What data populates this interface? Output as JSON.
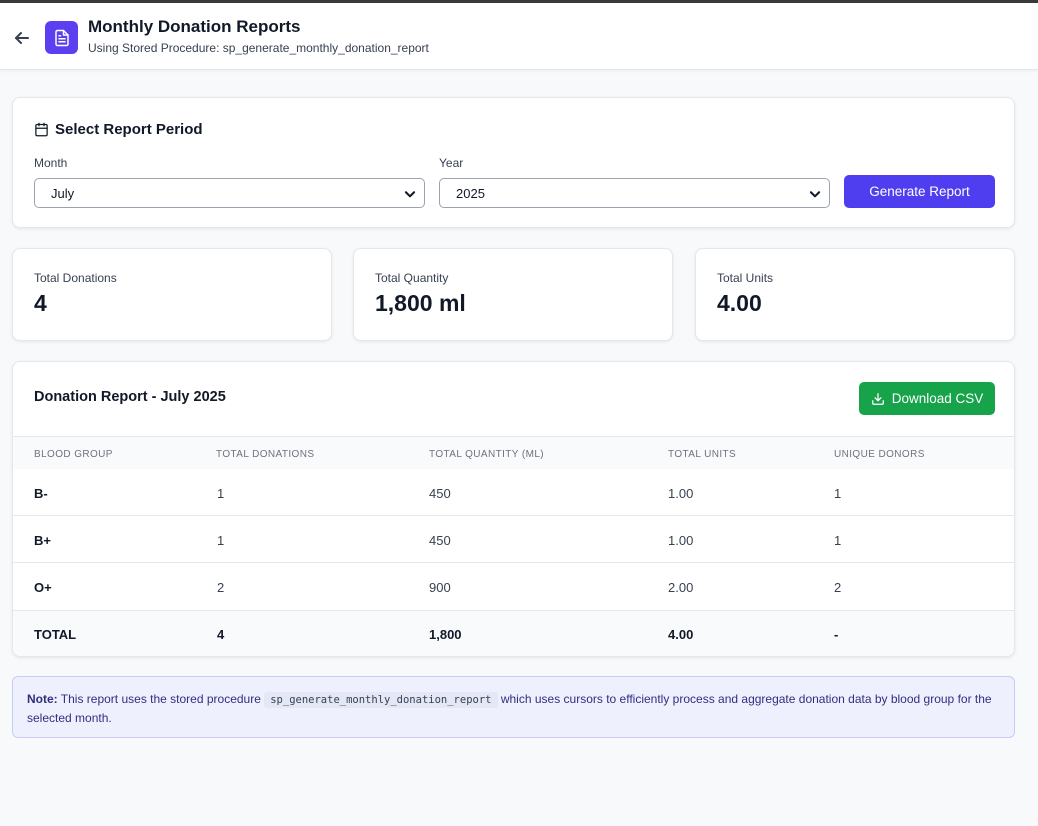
{
  "header": {
    "title": "Monthly Donation Reports",
    "subtitle": "Using Stored Procedure: sp_generate_monthly_donation_report"
  },
  "period": {
    "title": "Select Report Period",
    "month_label": "Month",
    "month_value": "July",
    "year_label": "Year",
    "year_value": "2025",
    "generate_label": "Generate Report"
  },
  "stats": [
    {
      "label": "Total Donations",
      "value": "4"
    },
    {
      "label": "Total Quantity",
      "value": "1,800 ml"
    },
    {
      "label": "Total Units",
      "value": "4.00"
    }
  ],
  "report": {
    "title": "Donation Report - July 2025",
    "download_label": "Download CSV",
    "columns": [
      "BLOOD GROUP",
      "TOTAL DONATIONS",
      "TOTAL QUANTITY (ML)",
      "TOTAL UNITS",
      "UNIQUE DONORS"
    ],
    "rows": [
      [
        "B-",
        "1",
        "450",
        "1.00",
        "1"
      ],
      [
        "B+",
        "1",
        "450",
        "1.00",
        "1"
      ],
      [
        "O+",
        "2",
        "900",
        "2.00",
        "2"
      ]
    ],
    "total": [
      "TOTAL",
      "4",
      "1,800",
      "4.00",
      "-"
    ]
  },
  "note": {
    "prefix": "Note:",
    "text_before": " This report uses the stored procedure ",
    "code": "sp_generate_monthly_donation_report",
    "text_after": " which uses cursors to efficiently process and aggregate donation data by blood group for the selected month."
  },
  "colors": {
    "accent": "#4f3ef0",
    "csv_button": "#16a34a",
    "note_bg": "#eef0fd"
  },
  "icons": {
    "back": "arrow-left-icon",
    "header": "document-icon",
    "period": "calendar-icon",
    "select": "chevron-down-icon",
    "csv": "download-icon"
  }
}
